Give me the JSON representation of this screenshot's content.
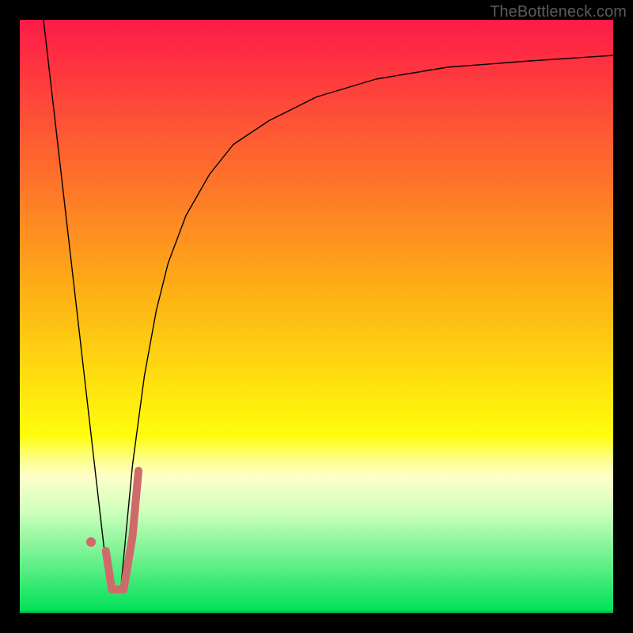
{
  "watermark": "TheBottleneck.com",
  "chart_data": {
    "type": "line",
    "title": "",
    "xlabel": "",
    "ylabel": "",
    "xlim": [
      0,
      100
    ],
    "ylim": [
      0,
      100
    ],
    "axes_visible": false,
    "grid": false,
    "background_gradient": {
      "type": "linear-vertical",
      "stops": [
        {
          "p": 0.0,
          "c": "#fe1a49"
        },
        {
          "p": 0.45,
          "c": "#fead16"
        },
        {
          "p": 0.7,
          "c": "#fffd0b"
        },
        {
          "p": 0.74,
          "c": "#fcfe87"
        },
        {
          "p": 0.77,
          "c": "#feffc9"
        },
        {
          "p": 0.83,
          "c": "#cdffbb"
        },
        {
          "p": 0.995,
          "c": "#02e15a"
        },
        {
          "p": 1.0,
          "c": "#059d41"
        }
      ]
    },
    "series": [
      {
        "name": "left-arm",
        "color": "#000000",
        "width": 1.4,
        "x": [
          4,
          15
        ],
        "y": [
          100,
          4
        ]
      },
      {
        "name": "right-arm",
        "color": "#000000",
        "width": 1.4,
        "x": [
          17,
          19,
          21,
          23,
          25,
          28,
          32,
          36,
          42,
          50,
          60,
          72,
          85,
          100
        ],
        "y": [
          4,
          25,
          40,
          51,
          59,
          67,
          74,
          79,
          83,
          87,
          90,
          92,
          93,
          94
        ]
      },
      {
        "name": "highlight-j",
        "color": "#cf6a6b",
        "width": 10,
        "cap": "round",
        "x": [
          14.5,
          15.5,
          17.5,
          19.0,
          20.0
        ],
        "y": [
          10.5,
          4.0,
          4.0,
          13.0,
          24.0
        ]
      }
    ],
    "markers": [
      {
        "name": "highlight-dot",
        "color": "#cf6a6b",
        "r": 6,
        "x": 12.0,
        "y": 12.0
      }
    ]
  }
}
